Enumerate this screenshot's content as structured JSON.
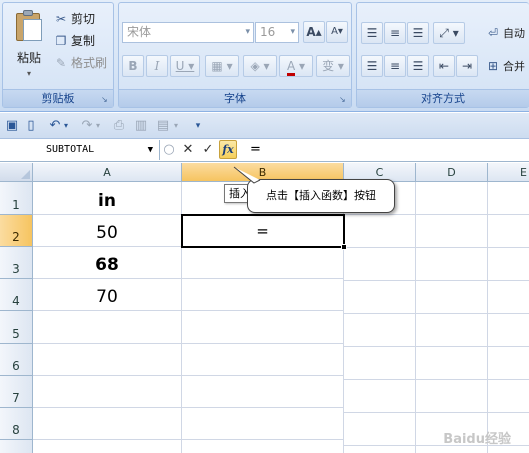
{
  "ribbon": {
    "clipboard": {
      "paste": "粘贴",
      "cut": "剪切",
      "copy": "复制",
      "format_painter": "格式刷",
      "group_label": "剪贴板"
    },
    "font": {
      "font_name": "宋体",
      "font_size": "16",
      "grow": "A",
      "shrink": "A",
      "bold": "B",
      "italic": "I",
      "underline": "U",
      "font_color": "A",
      "phonetic": "变",
      "group_label": "字体"
    },
    "alignment": {
      "wrap_text": "自动",
      "merge": "合并",
      "group_label": "对齐方式"
    }
  },
  "formula_bar": {
    "name_box": "SUBTOTAL",
    "cancel": "✕",
    "enter": "✓",
    "insert_function": "fx",
    "formula": "="
  },
  "grid": {
    "columns": [
      "A",
      "B",
      "C",
      "D",
      "E"
    ],
    "rows": [
      "1",
      "2",
      "3",
      "4",
      "5",
      "6",
      "7",
      "8"
    ],
    "cells": {
      "A1": "in",
      "A2": "50",
      "A3": "68",
      "A4": "70",
      "B2": "="
    },
    "tooltip": "插入",
    "callout": "点击【插入函数】按钮",
    "watermark": "Baidu经验"
  },
  "colors": {
    "accent": "#15428b",
    "selected_header": "#f6c460",
    "gridline": "#d0d7e5"
  }
}
